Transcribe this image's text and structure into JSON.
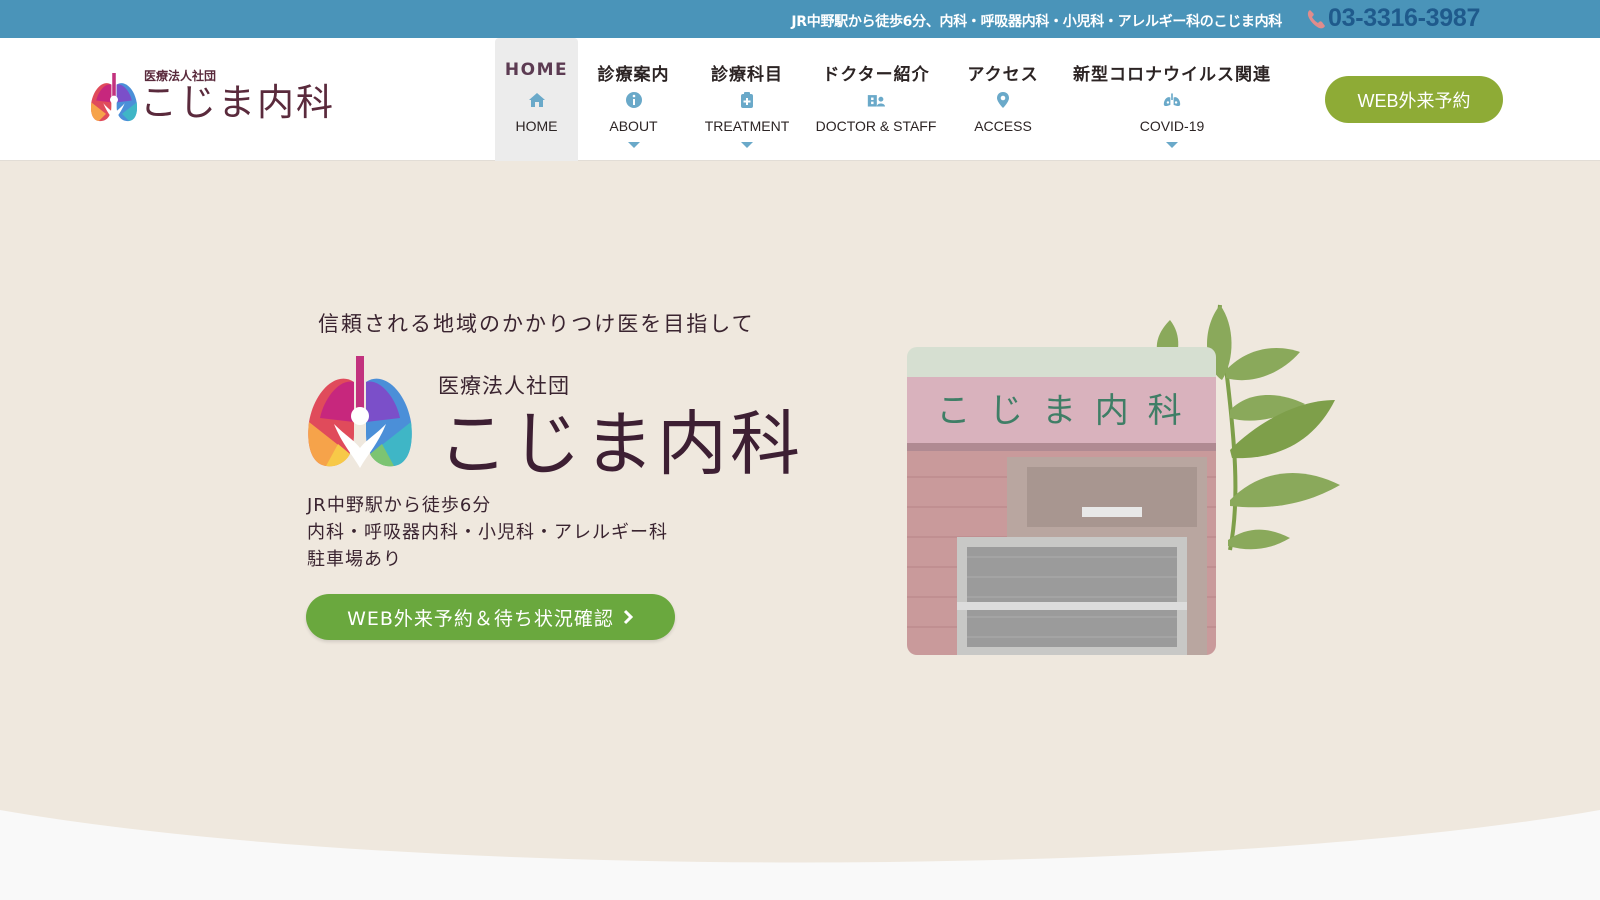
{
  "topbar": {
    "tagline": "JR中野駅から徒歩6分、内科・呼吸器内科・小児科・アレルギー科のこじま内科",
    "phone": "03-3316-3987",
    "phone_icon": "phone-icon"
  },
  "header": {
    "logo_sub": "医療法人社団",
    "logo_main": "こじま内科",
    "cta": "WEB外来予約"
  },
  "nav": [
    {
      "jp": "HOME",
      "en": "HOME",
      "icon": "home-icon",
      "active": true,
      "dropdown": false
    },
    {
      "jp": "診療案内",
      "en": "ABOUT",
      "icon": "info-icon",
      "active": false,
      "dropdown": true
    },
    {
      "jp": "診療科目",
      "en": "TREATMENT",
      "icon": "clipboard-medical-icon",
      "active": false,
      "dropdown": true
    },
    {
      "jp": "ドクター紹介",
      "en": "DOCTOR & STAFF",
      "icon": "hospital-user-icon",
      "active": false,
      "dropdown": false
    },
    {
      "jp": "アクセス",
      "en": "ACCESS",
      "icon": "map-pin-icon",
      "active": false,
      "dropdown": false
    },
    {
      "jp": "新型コロナウイルス関連",
      "en": "COVID-19",
      "icon": "lungs-virus-icon",
      "active": false,
      "dropdown": true
    }
  ],
  "hero": {
    "tagline": "信頼される地域のかかりつけ医を目指して",
    "logo_sub": "医療法人社団",
    "logo_main": "こじま内科",
    "info": [
      "JR中野駅から徒歩6分",
      "内科・呼吸器内科・小児科・アレルギー科",
      "駐車場あり"
    ],
    "cta": "WEB外来予約＆待ち状況確認",
    "photo_sign": "こ じ ま 内 科"
  },
  "colors": {
    "topbar": "#4a94b9",
    "phone": "#1f5a8c",
    "hero_bg": "#efe8de",
    "header_cta": "#8eab36",
    "hero_cta": "#6aa83e",
    "brand": "#5a2a3c"
  }
}
